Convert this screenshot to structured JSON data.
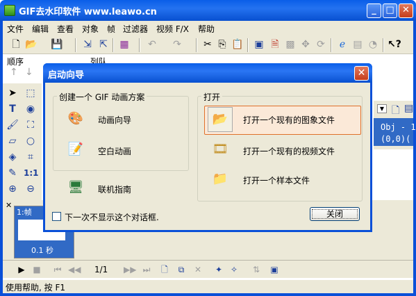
{
  "window": {
    "title": "GIF去水印软件 www.leawo.cn"
  },
  "menubar": [
    "文件",
    "编辑",
    "查看",
    "对象",
    "帧",
    "过滤器",
    "视频 F/X",
    "帮助"
  ],
  "panel_labels": {
    "order": "顺序",
    "queue": "列队"
  },
  "dialog": {
    "title": "启动向导",
    "create_group": {
      "label": "创建一个 GIF 动画方案",
      "items": [
        "动画向导",
        "空白动画"
      ]
    },
    "guide_item": "联机指南",
    "open_group": {
      "label": "打开",
      "items": [
        "打开一个现有的图象文件",
        "打开一个现有的视频文件",
        "打开一个样本文件"
      ]
    },
    "checkbox_label": "下一次不显示这个对话框.",
    "close_button": "关闭"
  },
  "right_panel": {
    "obj_line1": "Obj - 1",
    "obj_line2": "(0,0)("
  },
  "frames": {
    "header": "1:帧",
    "duration": "0.1 秒"
  },
  "playback": {
    "counter": "1/1"
  },
  "status": {
    "text": "使用帮助, 按 F1"
  },
  "colors": {
    "title_blue": "#0a5ee8",
    "frame_bg": "#ece9d8",
    "selected_frame": "#316ac5",
    "highlight_border": "#e0702a"
  }
}
